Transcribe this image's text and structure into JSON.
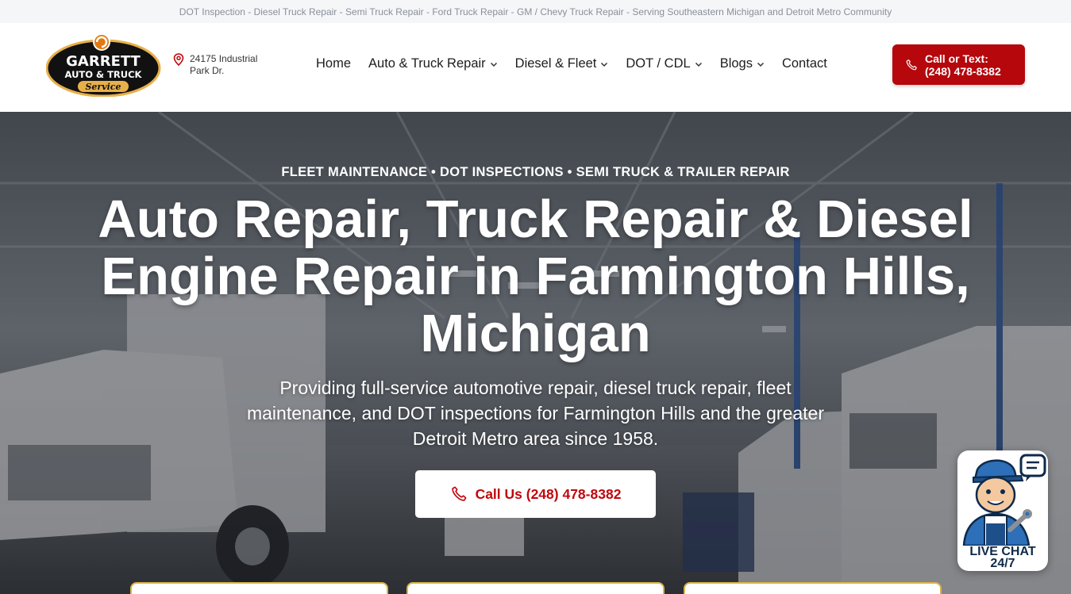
{
  "topbar": {
    "text": "DOT Inspection - Diesel Truck Repair - Semi Truck Repair - Ford Truck Repair - GM / Chevy Truck Repair - Serving Southeastern Michigan and Detroit Metro Community"
  },
  "header": {
    "logo": {
      "line1": "GARRETT",
      "line2": "AUTO & TRUCK",
      "line3": "Service"
    },
    "address": {
      "icon": "map-pin-icon",
      "line1": "24175 Industrial",
      "line2": "Park Dr."
    },
    "nav": [
      {
        "label": "Home",
        "has_dropdown": false
      },
      {
        "label": "Auto & Truck Repair",
        "has_dropdown": true
      },
      {
        "label": "Diesel & Fleet",
        "has_dropdown": true
      },
      {
        "label": "DOT / CDL",
        "has_dropdown": true
      },
      {
        "label": "Blogs",
        "has_dropdown": true
      },
      {
        "label": "Contact",
        "has_dropdown": false
      }
    ],
    "cta": {
      "icon": "phone-icon",
      "line1": "Call or Text:",
      "line2": "(248) 478-8382"
    }
  },
  "hero": {
    "eyebrow": "FLEET MAINTENANCE • DOT INSPECTIONS • SEMI TRUCK & TRAILER REPAIR",
    "headline": "Auto Repair, Truck Repair & Diesel Engine Repair in Farmington Hills, Michigan",
    "subhead": "Providing full-service automotive repair, diesel truck repair, fleet maintenance, and DOT inspections for Farmington Hills and the greater Detroit Metro area since 1958.",
    "cta_label": "Call Us (248) 478-8382",
    "cta_icon": "phone-icon"
  },
  "live_chat": {
    "line1": "LIVE CHAT",
    "line2": "24/7"
  },
  "colors": {
    "brand_red": "#b5070c",
    "cta_text_red": "#c0070d",
    "card_border_gold": "#d9b24a"
  }
}
